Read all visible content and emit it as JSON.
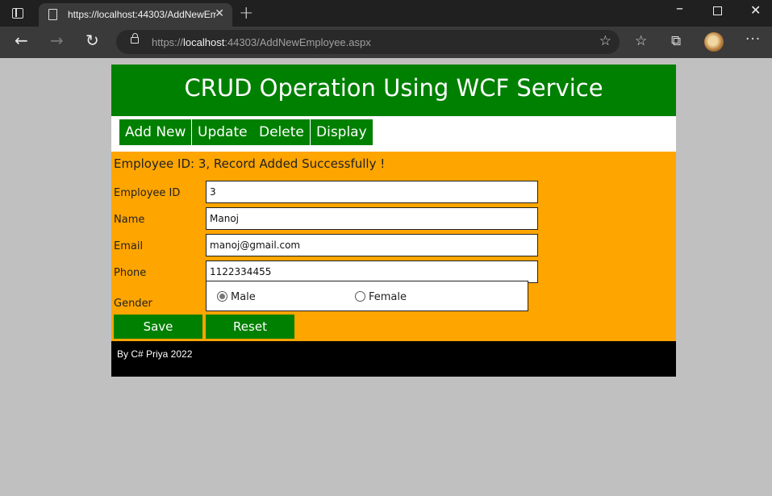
{
  "browser": {
    "tab_title": "https://localhost:44303/AddNewEmployee.aspx",
    "tab_close": "✕",
    "new_tab": "+",
    "url_prefix": "https://",
    "url_host": "localhost",
    "url_rest": ":44303/AddNewEmployee.aspx"
  },
  "icons": {
    "back": "arrow-left-icon",
    "forward": "arrow-right-icon",
    "reload": "reload-icon",
    "lock": "lock-icon",
    "add_favorite": "star-plus-icon",
    "favorites": "favorites-icon",
    "collections": "collections-icon",
    "more": "more-icon"
  },
  "page": {
    "header_title": "CRUD Operation Using WCF Service",
    "menu": [
      "Add New",
      "Update",
      "Delete",
      "Display"
    ],
    "message": "Employee ID: 3, Record Added Successfully !",
    "fields": {
      "employee_id": {
        "label": "Employee ID",
        "value": "3"
      },
      "name": {
        "label": "Name",
        "value": "Manoj"
      },
      "email": {
        "label": "Email",
        "value": "manoj@gmail.com"
      },
      "phone": {
        "label": "Phone",
        "value": "1122334455"
      }
    },
    "gender": {
      "label": "Gender",
      "options": [
        "Male",
        "Female"
      ],
      "selected": "Male"
    },
    "save_label": "Save",
    "reset_label": "Reset",
    "footer": "By C# Priya 2022"
  },
  "colors": {
    "header_bg": "#008000",
    "form_bg": "#ffa500",
    "footer_bg": "#000000",
    "page_bg": "#c0c0c0"
  }
}
